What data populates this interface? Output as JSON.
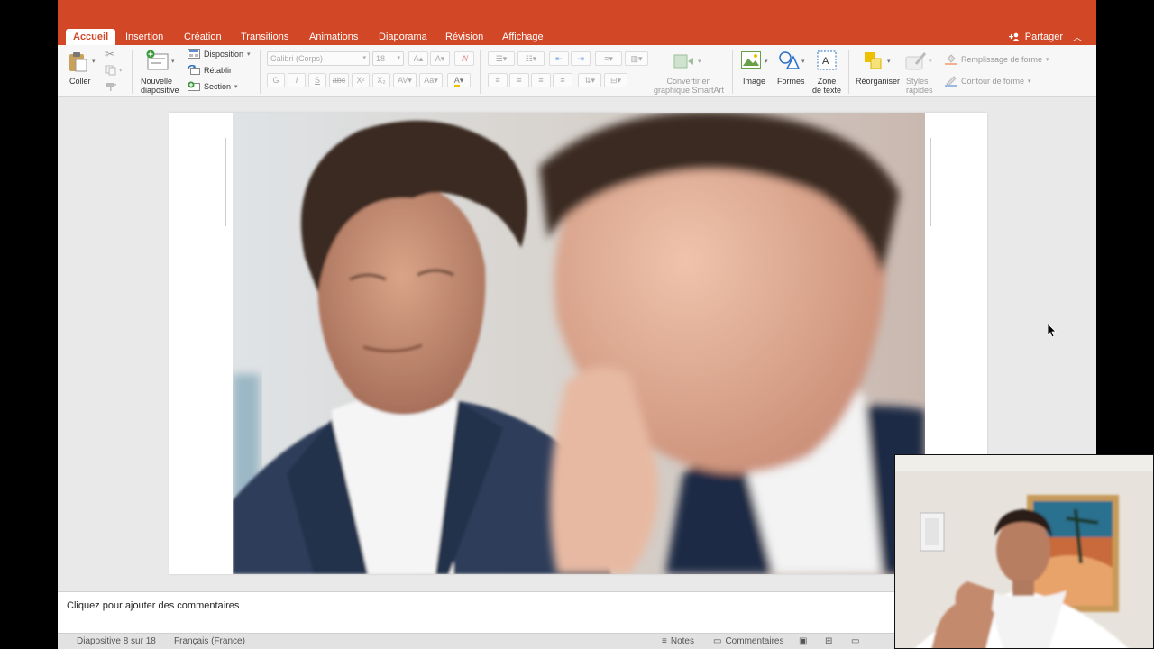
{
  "colors": {
    "accent": "#d24726",
    "ribbon_bg": "#f7f7f7",
    "workspace_bg": "#e9e9e9"
  },
  "tabs": [
    {
      "label": "Accueil",
      "active": true
    },
    {
      "label": "Insertion"
    },
    {
      "label": "Création"
    },
    {
      "label": "Transitions"
    },
    {
      "label": "Animations"
    },
    {
      "label": "Diaporama"
    },
    {
      "label": "Révision"
    },
    {
      "label": "Affichage"
    }
  ],
  "share": {
    "label": "Partager",
    "icon": "add-person-icon"
  },
  "ribbon": {
    "paste": "Coller",
    "new_slide": [
      "Nouvelle",
      "diapositive"
    ],
    "layout": "Disposition",
    "reset": "Rétablir",
    "section": "Section",
    "font_name": "Calibri (Corps)",
    "font_size": "18",
    "bold": "G",
    "italic": "I",
    "underline": "S",
    "strike": "abc",
    "superscript": "X²",
    "subscript": "X₂",
    "smartart": [
      "Convertir en",
      "graphique SmartArt"
    ],
    "image": "Image",
    "shapes": "Formes",
    "textbox": [
      "Zone",
      "de texte"
    ],
    "arrange": "Réorganiser",
    "quick_styles": [
      "Styles",
      "rapides"
    ],
    "shape_fill": "Remplissage de forme",
    "shape_outline": "Contour de forme"
  },
  "notes": {
    "placeholder": "Cliquez pour ajouter des commentaires"
  },
  "status": {
    "slide_counter": "Diapositive 8 sur 18",
    "language": "Français (France)",
    "notes_btn": "Notes",
    "comments_btn": "Commentaires"
  }
}
